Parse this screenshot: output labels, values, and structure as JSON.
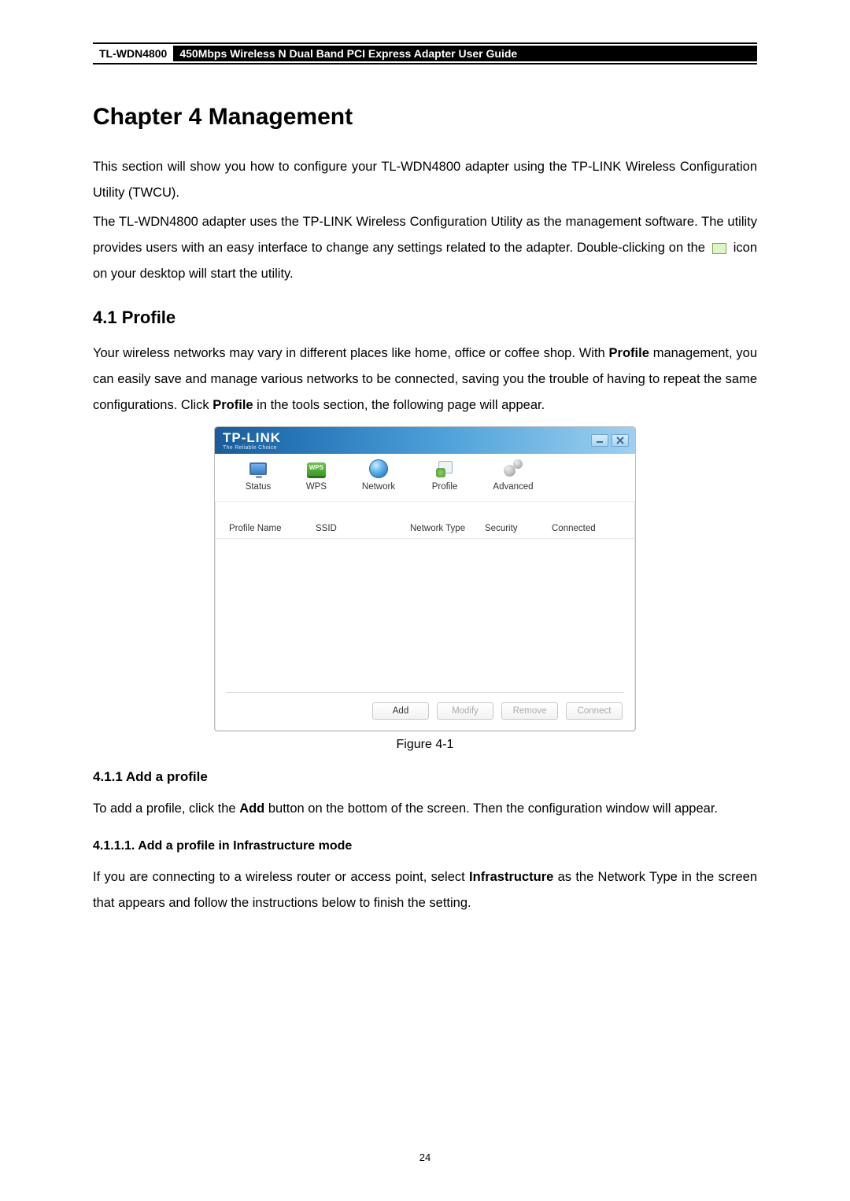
{
  "header": {
    "model": "TL-WDN4800",
    "guide_title": "450Mbps Wireless N Dual Band PCI Express Adapter User Guide"
  },
  "chapter_title": "Chapter 4  Management",
  "para1": "This section will show you how to configure your TL-WDN4800 adapter using the TP-LINK Wireless Configuration Utility (TWCU).",
  "para2a": "The TL-WDN4800 adapter uses the TP-LINK Wireless Configuration Utility as the management software. The utility provides users with an easy interface to change any settings related to the adapter. Double-clicking on the ",
  "para2b": " icon on your desktop will start the utility.",
  "section_profile": "4.1   Profile",
  "profile_para_a": "Your wireless networks may vary in different places like home, office or coffee shop. With ",
  "profile_bold1": "Profile",
  "profile_para_b": " management, you can easily save and manage various networks to be connected, saving you the trouble of having to repeat the same configurations. Click ",
  "profile_bold2": "Profile",
  "profile_para_c": " in the tools section, the following page will appear.",
  "app": {
    "brand": "TP-LINK",
    "brand_sub": "The Reliable Choice",
    "tabs": {
      "status": "Status",
      "wps": "WPS",
      "network": "Network",
      "profile": "Profile",
      "advanced": "Advanced"
    },
    "wps_badge": "WPS",
    "columns": {
      "profile_name": "Profile Name",
      "ssid": "SSID",
      "network_type": "Network Type",
      "security": "Security",
      "connected": "Connected"
    },
    "buttons": {
      "add": "Add",
      "modify": "Modify",
      "remove": "Remove",
      "connect": "Connect"
    }
  },
  "figure_caption": "Figure 4-1",
  "subsection_add": "4.1.1  Add a profile",
  "add_para_a": "To add a profile, click the ",
  "add_bold": "Add",
  "add_para_b": " button on the bottom of the screen. Then the configuration window will appear.",
  "subsub_infra": "4.1.1.1.  Add a profile in Infrastructure mode",
  "infra_para_a": "If you are connecting to a wireless router or access point, select ",
  "infra_bold": "Infrastructure",
  "infra_para_b": " as the Network Type in the screen that appears and follow the instructions below to finish the setting.",
  "page_number": "24"
}
